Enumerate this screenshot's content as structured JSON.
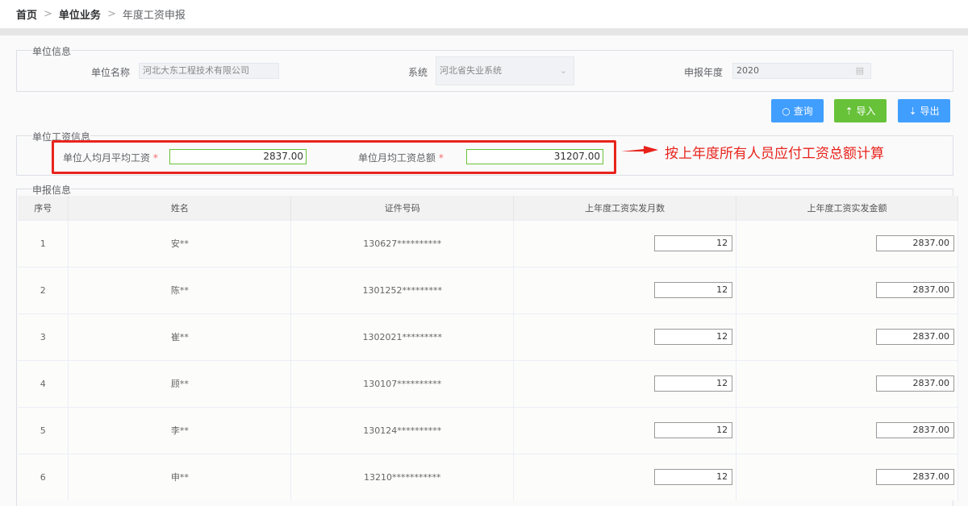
{
  "breadcrumb": [
    "首页",
    "单位业务",
    "年度工资申报"
  ],
  "unit_info": {
    "legend": "单位信息",
    "name_label": "单位名称",
    "name_value": "河北大东工程技术有限公司",
    "system_label": "系统",
    "system_value": "河北省失业系统",
    "year_label": "申报年度",
    "year_value": "2020"
  },
  "buttons": {
    "query": "查询",
    "import": "导入",
    "export": "导出"
  },
  "wage_info": {
    "legend": "单位工资信息",
    "avg_label": "单位人均月平均工资",
    "avg_value": "2837.00",
    "total_label": "单位月均工资总额",
    "total_value": "31207.00"
  },
  "annotation": "按上年度所有人员应付工资总额计算",
  "declare": {
    "legend": "申报信息",
    "columns": [
      "序号",
      "姓名",
      "证件号码",
      "上年度工资实发月数",
      "上年度工资实发金额"
    ],
    "rows": [
      {
        "no": "1",
        "name": "安**",
        "id": "130627**********",
        "months": "12",
        "amount": "2837.00"
      },
      {
        "no": "2",
        "name": "陈**",
        "id": "1301252*********",
        "months": "12",
        "amount": "2837.00"
      },
      {
        "no": "3",
        "name": "崔**",
        "id": "1302021*********",
        "months": "12",
        "amount": "2837.00"
      },
      {
        "no": "4",
        "name": "顾**",
        "id": "130107**********",
        "months": "12",
        "amount": "2837.00"
      },
      {
        "no": "5",
        "name": "李**",
        "id": "130124**********",
        "months": "12",
        "amount": "2837.00"
      },
      {
        "no": "6",
        "name": "申**",
        "id": "13210***********",
        "months": "12",
        "amount": "2837.00"
      }
    ]
  }
}
